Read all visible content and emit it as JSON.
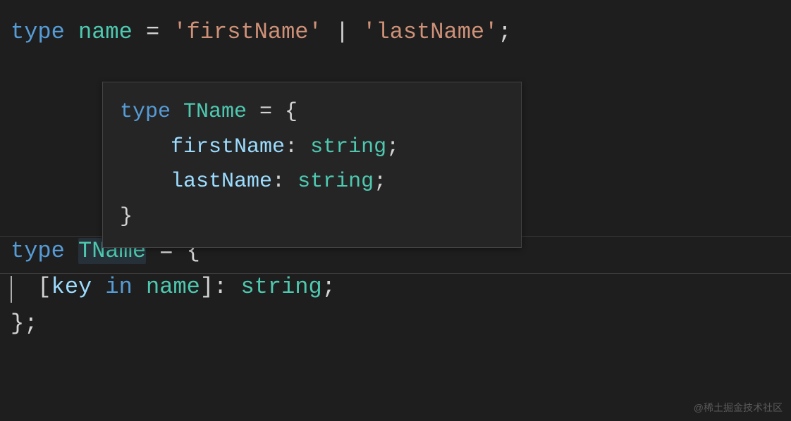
{
  "line1": {
    "keyword": "type",
    "name": "name",
    "equals": "=",
    "str1": "'firstName'",
    "pipe": "|",
    "str2": "'lastName'",
    "semi": ";"
  },
  "tooltip": {
    "l1_keyword": "type",
    "l1_name": "TName",
    "l1_rest": " = {",
    "l2_prop": "firstName",
    "l2_colon": ": ",
    "l2_type": "string",
    "l2_semi": ";",
    "l3_prop": "lastName",
    "l3_colon": ": ",
    "l3_type": "string",
    "l3_semi": ";",
    "l4": "}"
  },
  "line2": {
    "keyword": "type",
    "name": "TName",
    "rest": " = {"
  },
  "line3": {
    "bracket_open": "[",
    "key": "key",
    "in": "in",
    "name": "name",
    "bracket_close": "]",
    "colon": ": ",
    "type": "string",
    "semi": ";"
  },
  "line4": {
    "close": "};"
  },
  "watermark": "@稀土掘金技术社区"
}
